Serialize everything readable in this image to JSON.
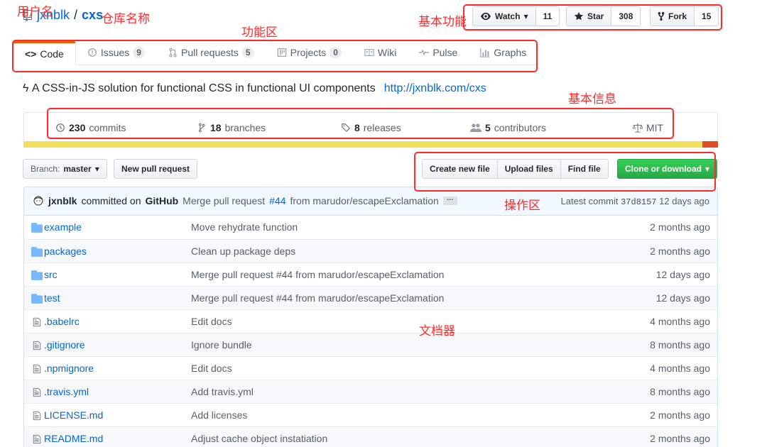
{
  "repo": {
    "owner": "jxnblk",
    "separator": "/",
    "name": "cxs"
  },
  "actions": {
    "watch": {
      "label": "Watch",
      "count": "11"
    },
    "star": {
      "label": "Star",
      "count": "308"
    },
    "fork": {
      "label": "Fork",
      "count": "15"
    }
  },
  "tabs": [
    {
      "label": "Code",
      "icon": "code-icon",
      "selected": true
    },
    {
      "label": "Issues",
      "icon": "issue-icon",
      "counter": "9"
    },
    {
      "label": "Pull requests",
      "icon": "pull-request-icon",
      "counter": "5"
    },
    {
      "label": "Projects",
      "icon": "project-icon",
      "counter": "0"
    },
    {
      "label": "Wiki",
      "icon": "book-icon"
    },
    {
      "label": "Pulse",
      "icon": "pulse-icon"
    },
    {
      "label": "Graphs",
      "icon": "graph-icon"
    }
  ],
  "description": {
    "text": "ϟ A CSS-in-JS solution for functional CSS in functional UI components",
    "url": "http://jxnblk.com/cxs"
  },
  "summary": {
    "commits": {
      "count": "230",
      "label": "commits"
    },
    "branches": {
      "count": "18",
      "label": "branches"
    },
    "releases": {
      "count": "8",
      "label": "releases"
    },
    "contributors": {
      "count": "5",
      "label": "contributors"
    },
    "license": "MIT"
  },
  "language_bar": [
    {
      "color": "#f1e05a",
      "fraction": 0.977
    },
    {
      "color": "#e34c26",
      "fraction": 0.023
    }
  ],
  "file_nav": {
    "branch_label": "Branch:",
    "branch": "master",
    "new_pull_request": "New pull request",
    "create_new_file": "Create new file",
    "upload_files": "Upload files",
    "find_file": "Find file",
    "clone": "Clone or download"
  },
  "latest_commit": {
    "author": "jxnblk",
    "committed_on": "committed on",
    "platform": "GitHub",
    "message_before": "Merge pull request",
    "pr_link": "#44",
    "message_after": "from marudor/escapeExclamation",
    "ellipsis": "…",
    "label": "Latest commit",
    "sha": "37d8157",
    "age": "12 days ago"
  },
  "files": [
    {
      "type": "dir",
      "name": "example",
      "message": "Move rehydrate function",
      "age": "2 months ago"
    },
    {
      "type": "dir",
      "name": "packages",
      "message": "Clean up package deps",
      "age": "2 months ago"
    },
    {
      "type": "dir",
      "name": "src",
      "message": "Merge pull request #44 from marudor/escapeExclamation",
      "age": "12 days ago"
    },
    {
      "type": "dir",
      "name": "test",
      "message": "Merge pull request #44 from marudor/escapeExclamation",
      "age": "12 days ago"
    },
    {
      "type": "file",
      "name": ".babelrc",
      "message": "Edit docs",
      "age": "4 months ago"
    },
    {
      "type": "file",
      "name": ".gitignore",
      "message": "Ignore bundle",
      "age": "8 months ago"
    },
    {
      "type": "file",
      "name": ".npmignore",
      "message": "Edit docs",
      "age": "4 months ago"
    },
    {
      "type": "file",
      "name": ".travis.yml",
      "message": "Add travis.yml",
      "age": "8 months ago"
    },
    {
      "type": "file",
      "name": "LICENSE.md",
      "message": "Add licenses",
      "age": "2 months ago"
    },
    {
      "type": "file",
      "name": "README.md",
      "message": "Adjust cache object instatiation",
      "age": "2 months ago"
    }
  ],
  "annotations": {
    "username": "用户名",
    "repo_name": "仓库名称",
    "basic_functions": "基本功能",
    "function_area": "功能区",
    "basic_info": "基本信息",
    "operation_area": "操作区",
    "file_list": "文档器"
  },
  "colors": {
    "link": "#0366d6",
    "annotation": "#ff2b2b",
    "clone_green": "#28a745",
    "tab_accent": "#e36209",
    "commit_bg": "#f1f8ff"
  }
}
